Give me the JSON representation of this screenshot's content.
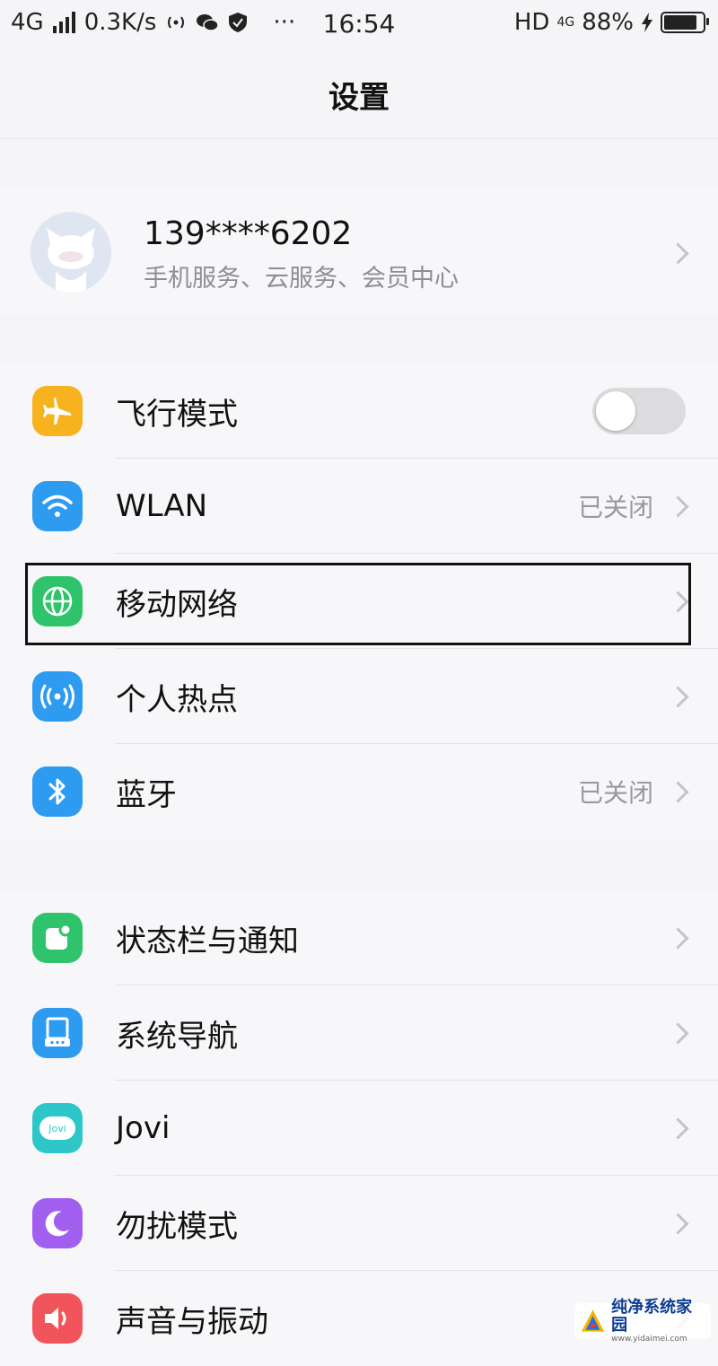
{
  "status_bar": {
    "network": "4G",
    "speed": "0.3K/s",
    "dots": "···",
    "time": "16:54",
    "hd": "HD",
    "net2": "4G",
    "battery": "88%",
    "battery_level": 0.88
  },
  "title": "设置",
  "account": {
    "phone": "139****6202",
    "subtitle": "手机服务、云服务、会员中心"
  },
  "group1": [
    {
      "label": "飞行模式",
      "icon": "airplane-icon",
      "color": "#f7b21f",
      "toggle": false
    },
    {
      "label": "WLAN",
      "icon": "wifi-icon",
      "color": "#2d9bf0",
      "value": "已关闭"
    },
    {
      "label": "移动网络",
      "icon": "globe-icon",
      "color": "#2fc46b"
    },
    {
      "label": "个人热点",
      "icon": "hotspot-icon",
      "color": "#2d9bf0"
    },
    {
      "label": "蓝牙",
      "icon": "bluetooth-icon",
      "color": "#2d9bf0",
      "value": "已关闭"
    }
  ],
  "group2": [
    {
      "label": "状态栏与通知",
      "icon": "notification-icon",
      "color": "#2fc46b"
    },
    {
      "label": "系统导航",
      "icon": "navigation-icon",
      "color": "#2d9bf0"
    },
    {
      "label": "Jovi",
      "icon": "jovi-icon",
      "color": "#2ec7c9",
      "icon_text": "Jovi"
    },
    {
      "label": "勿扰模式",
      "icon": "moon-icon",
      "color": "#a15ff0"
    },
    {
      "label": "声音与振动",
      "icon": "speaker-icon",
      "color": "#f2545b"
    }
  ],
  "watermark": {
    "text": "纯净系统家园",
    "url": "www.yidaimei.com"
  }
}
